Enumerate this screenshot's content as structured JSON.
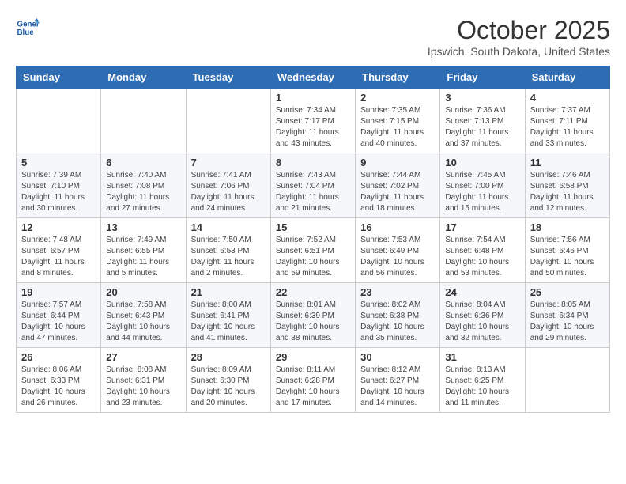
{
  "header": {
    "logo_line1": "General",
    "logo_line2": "Blue",
    "month": "October 2025",
    "location": "Ipswich, South Dakota, United States"
  },
  "weekdays": [
    "Sunday",
    "Monday",
    "Tuesday",
    "Wednesday",
    "Thursday",
    "Friday",
    "Saturday"
  ],
  "weeks": [
    [
      {
        "day": "",
        "info": ""
      },
      {
        "day": "",
        "info": ""
      },
      {
        "day": "",
        "info": ""
      },
      {
        "day": "1",
        "info": "Sunrise: 7:34 AM\nSunset: 7:17 PM\nDaylight: 11 hours\nand 43 minutes."
      },
      {
        "day": "2",
        "info": "Sunrise: 7:35 AM\nSunset: 7:15 PM\nDaylight: 11 hours\nand 40 minutes."
      },
      {
        "day": "3",
        "info": "Sunrise: 7:36 AM\nSunset: 7:13 PM\nDaylight: 11 hours\nand 37 minutes."
      },
      {
        "day": "4",
        "info": "Sunrise: 7:37 AM\nSunset: 7:11 PM\nDaylight: 11 hours\nand 33 minutes."
      }
    ],
    [
      {
        "day": "5",
        "info": "Sunrise: 7:39 AM\nSunset: 7:10 PM\nDaylight: 11 hours\nand 30 minutes."
      },
      {
        "day": "6",
        "info": "Sunrise: 7:40 AM\nSunset: 7:08 PM\nDaylight: 11 hours\nand 27 minutes."
      },
      {
        "day": "7",
        "info": "Sunrise: 7:41 AM\nSunset: 7:06 PM\nDaylight: 11 hours\nand 24 minutes."
      },
      {
        "day": "8",
        "info": "Sunrise: 7:43 AM\nSunset: 7:04 PM\nDaylight: 11 hours\nand 21 minutes."
      },
      {
        "day": "9",
        "info": "Sunrise: 7:44 AM\nSunset: 7:02 PM\nDaylight: 11 hours\nand 18 minutes."
      },
      {
        "day": "10",
        "info": "Sunrise: 7:45 AM\nSunset: 7:00 PM\nDaylight: 11 hours\nand 15 minutes."
      },
      {
        "day": "11",
        "info": "Sunrise: 7:46 AM\nSunset: 6:58 PM\nDaylight: 11 hours\nand 12 minutes."
      }
    ],
    [
      {
        "day": "12",
        "info": "Sunrise: 7:48 AM\nSunset: 6:57 PM\nDaylight: 11 hours\nand 8 minutes."
      },
      {
        "day": "13",
        "info": "Sunrise: 7:49 AM\nSunset: 6:55 PM\nDaylight: 11 hours\nand 5 minutes."
      },
      {
        "day": "14",
        "info": "Sunrise: 7:50 AM\nSunset: 6:53 PM\nDaylight: 11 hours\nand 2 minutes."
      },
      {
        "day": "15",
        "info": "Sunrise: 7:52 AM\nSunset: 6:51 PM\nDaylight: 10 hours\nand 59 minutes."
      },
      {
        "day": "16",
        "info": "Sunrise: 7:53 AM\nSunset: 6:49 PM\nDaylight: 10 hours\nand 56 minutes."
      },
      {
        "day": "17",
        "info": "Sunrise: 7:54 AM\nSunset: 6:48 PM\nDaylight: 10 hours\nand 53 minutes."
      },
      {
        "day": "18",
        "info": "Sunrise: 7:56 AM\nSunset: 6:46 PM\nDaylight: 10 hours\nand 50 minutes."
      }
    ],
    [
      {
        "day": "19",
        "info": "Sunrise: 7:57 AM\nSunset: 6:44 PM\nDaylight: 10 hours\nand 47 minutes."
      },
      {
        "day": "20",
        "info": "Sunrise: 7:58 AM\nSunset: 6:43 PM\nDaylight: 10 hours\nand 44 minutes."
      },
      {
        "day": "21",
        "info": "Sunrise: 8:00 AM\nSunset: 6:41 PM\nDaylight: 10 hours\nand 41 minutes."
      },
      {
        "day": "22",
        "info": "Sunrise: 8:01 AM\nSunset: 6:39 PM\nDaylight: 10 hours\nand 38 minutes."
      },
      {
        "day": "23",
        "info": "Sunrise: 8:02 AM\nSunset: 6:38 PM\nDaylight: 10 hours\nand 35 minutes."
      },
      {
        "day": "24",
        "info": "Sunrise: 8:04 AM\nSunset: 6:36 PM\nDaylight: 10 hours\nand 32 minutes."
      },
      {
        "day": "25",
        "info": "Sunrise: 8:05 AM\nSunset: 6:34 PM\nDaylight: 10 hours\nand 29 minutes."
      }
    ],
    [
      {
        "day": "26",
        "info": "Sunrise: 8:06 AM\nSunset: 6:33 PM\nDaylight: 10 hours\nand 26 minutes."
      },
      {
        "day": "27",
        "info": "Sunrise: 8:08 AM\nSunset: 6:31 PM\nDaylight: 10 hours\nand 23 minutes."
      },
      {
        "day": "28",
        "info": "Sunrise: 8:09 AM\nSunset: 6:30 PM\nDaylight: 10 hours\nand 20 minutes."
      },
      {
        "day": "29",
        "info": "Sunrise: 8:11 AM\nSunset: 6:28 PM\nDaylight: 10 hours\nand 17 minutes."
      },
      {
        "day": "30",
        "info": "Sunrise: 8:12 AM\nSunset: 6:27 PM\nDaylight: 10 hours\nand 14 minutes."
      },
      {
        "day": "31",
        "info": "Sunrise: 8:13 AM\nSunset: 6:25 PM\nDaylight: 10 hours\nand 11 minutes."
      },
      {
        "day": "",
        "info": ""
      }
    ]
  ]
}
